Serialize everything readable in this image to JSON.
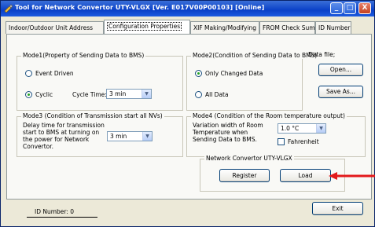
{
  "window": {
    "title": "Tool for Network Convertor UTY-VLGX [Ver. E017V00P00103] [Online]",
    "minimize": "_",
    "maximize": "□",
    "close": "X"
  },
  "tabs": [
    {
      "label": "Indoor/Outdoor Unit Address"
    },
    {
      "label": "Configuration Properties"
    },
    {
      "label": "XIF Making/Modifying"
    },
    {
      "label": "FROM Check Sum"
    },
    {
      "label": "ID Number"
    }
  ],
  "mode1": {
    "title": "Mode1(Property of Sending Data to BMS)",
    "event_driven": "Event Driven",
    "cyclic": "Cyclic",
    "cycle_time_label": "Cycle Time:",
    "cycle_time_value": "3 min"
  },
  "mode2": {
    "title": "Mode2(Condition of Sending Data to BMS)",
    "only_changed": "Only Changed Data",
    "all_data": "All Data"
  },
  "datafile": {
    "title": "Data file;",
    "open": "Open...",
    "save_as": "Save As..."
  },
  "mode3": {
    "title": "Mode3 (Condition of Transmission start all NVs)",
    "line1": "Delay time for transmission",
    "line2": "start to BMS at turning on",
    "line3": "the power for Network",
    "line4": "Convertor.",
    "value": "3 min"
  },
  "mode4": {
    "title": "Mode4 (Condition of the Room temperature output)",
    "line1": "Variation width of Room",
    "line2": "Temperature when",
    "line3": "Sending Data to BMS.",
    "value": "1.0 °C",
    "fahrenheit": "Fahrenheit"
  },
  "network": {
    "title": "Network Convertor UTY-VLGX",
    "register": "Register",
    "load": "Load"
  },
  "footer": {
    "id_number": "ID Number:  0",
    "exit": "Exit"
  },
  "colors": {
    "annotation_arrow": "#e3191b"
  }
}
